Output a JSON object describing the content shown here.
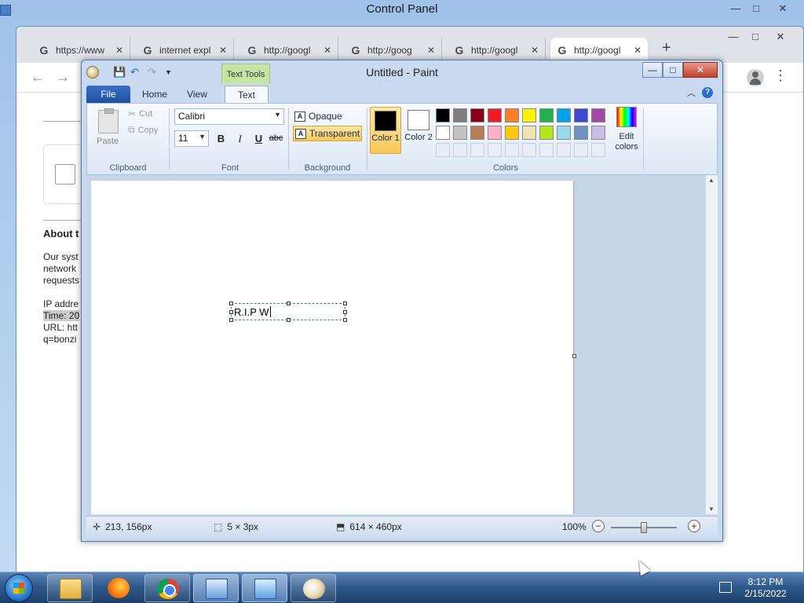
{
  "control_panel": {
    "title": "Control Panel",
    "controls": [
      "—",
      "□",
      "✕"
    ]
  },
  "chrome": {
    "tabs": [
      {
        "label": "https://www",
        "active": false
      },
      {
        "label": "internet expl",
        "active": false
      },
      {
        "label": "http://googl",
        "active": false
      },
      {
        "label": "http://goog",
        "active": false
      },
      {
        "label": "http://googl",
        "active": false
      },
      {
        "label": "http://googl",
        "active": true
      }
    ],
    "new_tab": "+",
    "page": {
      "heading_fragment": "About t",
      "para_lines": [
        "Our syst",
        "network",
        "requests"
      ],
      "ip_line": "IP addre",
      "time_line": "Time: 20",
      "url_line": "URL: htt",
      "query_line": "q=bonzi"
    }
  },
  "paint": {
    "title": "Untitled - Paint",
    "context_tab": "Text Tools",
    "tabs": [
      "File",
      "Home",
      "View",
      "Text"
    ],
    "clipboard": {
      "group": "Clipboard",
      "paste": "Paste",
      "cut": "Cut",
      "copy": "Copy"
    },
    "font": {
      "group": "Font",
      "name": "Calibri",
      "size": "11",
      "bold": "B",
      "italic": "I",
      "underline": "U",
      "strike": "abc"
    },
    "background": {
      "group": "Background",
      "opaque": "Opaque",
      "transparent": "Transparent",
      "selected": "Transparent"
    },
    "colors": {
      "group": "Colors",
      "color1_label": "Color 1",
      "color1": "#000000",
      "color2_label": "Color 2",
      "color2": "#ffffff",
      "edit_label": "Edit colors",
      "palette_row1": [
        "#000000",
        "#7f7f7f",
        "#880015",
        "#ed1c24",
        "#ff7f27",
        "#fff200",
        "#22b14c",
        "#00a2e8",
        "#3f48cc",
        "#a349a4"
      ],
      "palette_row2": [
        "#ffffff",
        "#c3c3c3",
        "#b97a57",
        "#ffaec9",
        "#ffc90e",
        "#efe4b0",
        "#b5e61d",
        "#99d9ea",
        "#7092be",
        "#c8bfe7"
      ]
    },
    "canvas_text": "R.I.P W",
    "status": {
      "cursor_pos": "213, 156px",
      "selection": "5 × 3px",
      "canvas_size": "614 × 460px",
      "zoom": "100%"
    }
  },
  "taskbar": {
    "apps": [
      "windows-explorer",
      "firefox",
      "google-chrome",
      "task-manager",
      "control-panel",
      "paint"
    ],
    "time": "8:12 PM",
    "date": "2/15/2022"
  }
}
